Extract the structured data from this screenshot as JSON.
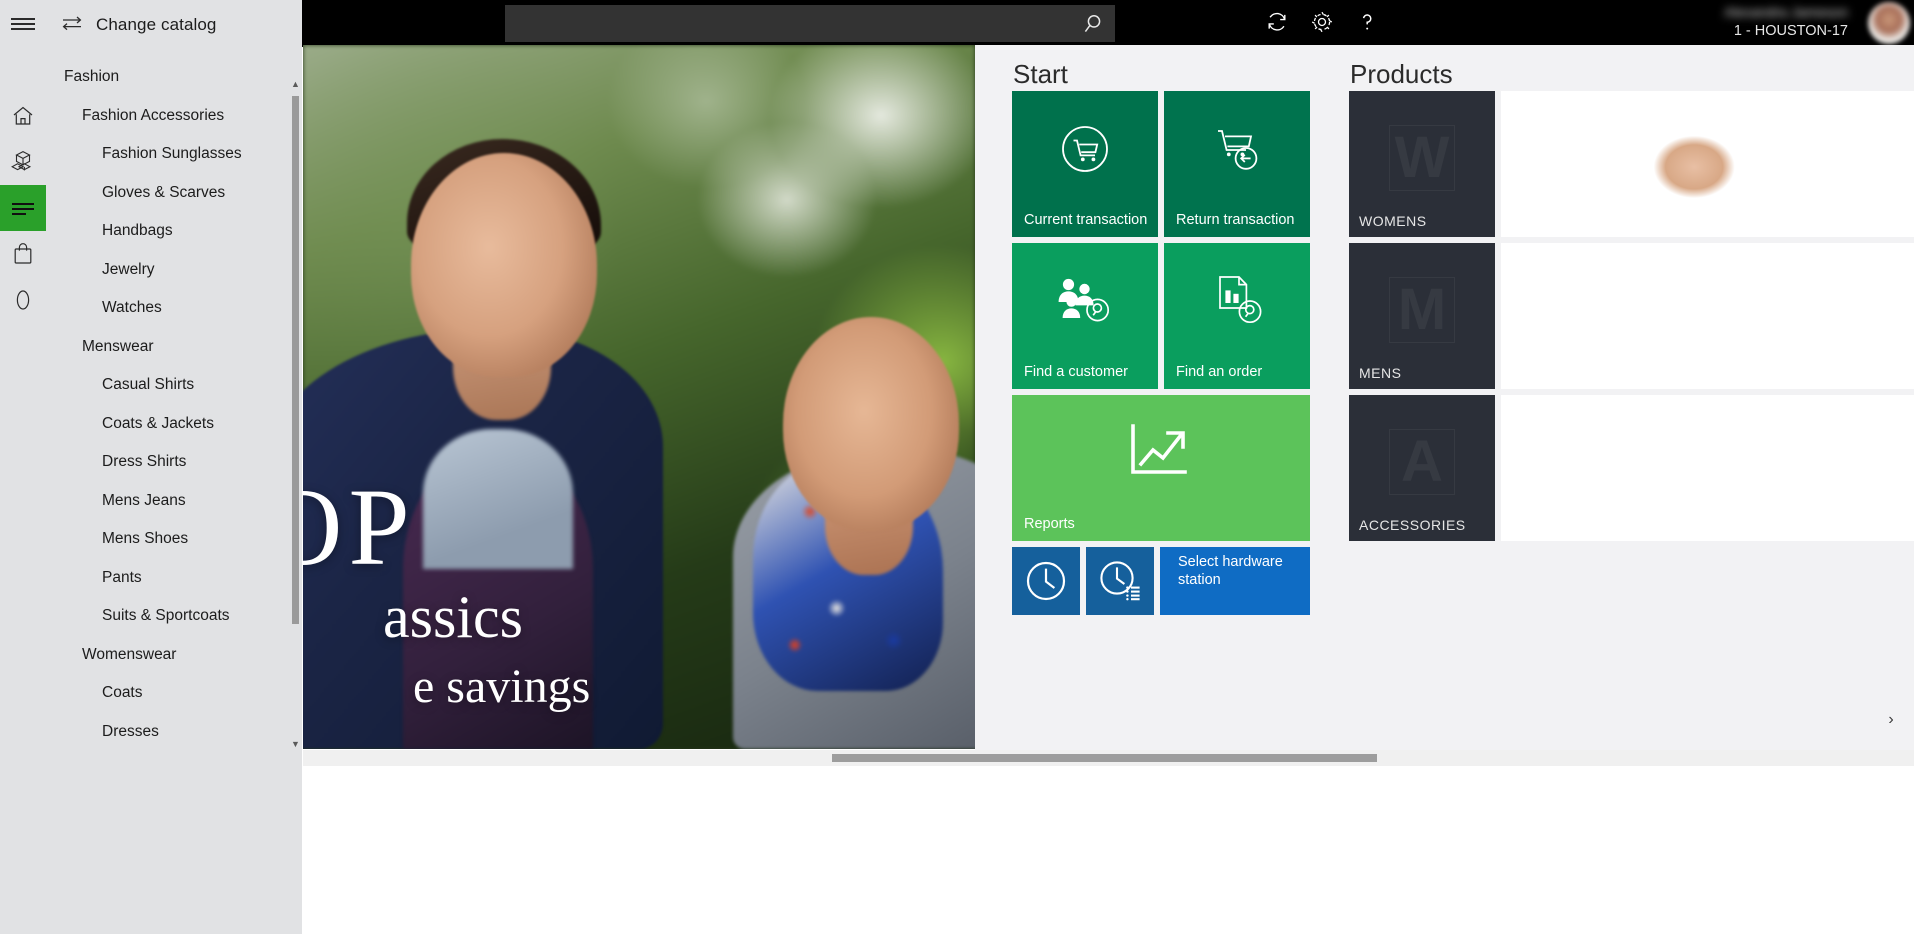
{
  "app": {
    "accent_green": "#2aa02a",
    "tile_dark_green": "#00714c",
    "tile_green": "#0a9e5e",
    "tile_light_green": "#5cc35a",
    "tile_blue": "#15609c",
    "tile_blue_bright": "#0f6cc4",
    "product_tile_bg": "#2b2f38",
    "panel_bg": "#f2f2f4",
    "sidebar_bg": "#e1e2e4",
    "topbar_bg": "#000000"
  },
  "topbar": {
    "search_placeholder": "",
    "search_value": "",
    "search_icon": "search-icon",
    "refresh_icon": "refresh-icon",
    "settings_icon": "gear-icon",
    "help_icon": "question-mark-icon",
    "user_name": "Alexandra Jameson",
    "user_terminal": "1 - HOUSTON-17",
    "avatar_label": "avatar"
  },
  "sidebar": {
    "hamburger_label": "menu-icon",
    "change_catalog_label": "Change catalog",
    "change_catalog_icon": "swap-arrows-icon",
    "rail_items": [
      {
        "name": "home",
        "icon": "home-icon",
        "active": false
      },
      {
        "name": "products",
        "icon": "boxes-icon",
        "active": false
      },
      {
        "name": "catalog",
        "icon": "list-lines-icon",
        "active": true
      },
      {
        "name": "cart",
        "icon": "shopping-bag-icon",
        "active": false
      },
      {
        "name": "zero",
        "icon": "zero-digit-icon",
        "active": false
      }
    ],
    "catalog_nodes": [
      {
        "label": "Fashion",
        "level": 0
      },
      {
        "label": "Fashion Accessories",
        "level": 1
      },
      {
        "label": "Fashion Sunglasses",
        "level": 2
      },
      {
        "label": "Gloves & Scarves",
        "level": 2
      },
      {
        "label": "Handbags",
        "level": 2
      },
      {
        "label": "Jewelry",
        "level": 2
      },
      {
        "label": "Watches",
        "level": 2
      },
      {
        "label": "Menswear",
        "level": 1
      },
      {
        "label": "Casual Shirts",
        "level": 2
      },
      {
        "label": "Coats & Jackets",
        "level": 2
      },
      {
        "label": "Dress Shirts",
        "level": 2
      },
      {
        "label": "Mens Jeans",
        "level": 2
      },
      {
        "label": "Mens Shoes",
        "level": 2
      },
      {
        "label": "Pants",
        "level": 2
      },
      {
        "label": "Suits & Sportcoats",
        "level": 2
      },
      {
        "label": "Womenswear",
        "level": 1
      },
      {
        "label": "Coats",
        "level": 2
      },
      {
        "label": "Dresses",
        "level": 2
      }
    ],
    "scroll_up_glyph": "▲",
    "scroll_down_glyph": "▼"
  },
  "hero": {
    "line1": "OP",
    "line2": "assics",
    "line3": "e savings"
  },
  "start": {
    "title": "Start",
    "tiles": [
      {
        "id": "current-transaction",
        "label": "Current transaction",
        "icon": "cart-in-circle-icon"
      },
      {
        "id": "return-transaction",
        "label": "Return transaction",
        "icon": "cart-with-back-arrow-icon"
      },
      {
        "id": "find-a-customer",
        "label": "Find a customer",
        "icon": "people-with-magnifier-icon"
      },
      {
        "id": "find-an-order",
        "label": "Find an order",
        "icon": "document-with-magnifier-icon"
      },
      {
        "id": "reports",
        "label": "Reports",
        "icon": "line-chart-arrow-icon"
      },
      {
        "id": "time-clock",
        "label": "",
        "icon": "clock-icon"
      },
      {
        "id": "time-clock-entries",
        "label": "",
        "icon": "clock-with-list-icon"
      },
      {
        "id": "select-hardware-station",
        "label": "Select hardware station",
        "icon": ""
      }
    ]
  },
  "products": {
    "title": "Products",
    "next_arrow_glyph": "›",
    "rows": [
      {
        "label": "WOMENS",
        "letter": "W"
      },
      {
        "label": "MENS",
        "letter": "M"
      },
      {
        "label": "ACCESSORIES",
        "letter": "A"
      }
    ]
  },
  "scrollbar": {
    "right_arrow_glyph": "▶"
  }
}
